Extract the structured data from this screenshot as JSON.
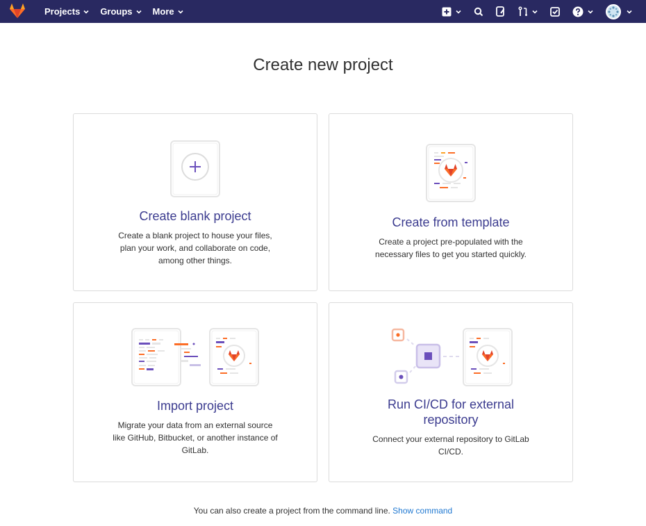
{
  "navbar": {
    "items": [
      {
        "label": "Projects"
      },
      {
        "label": "Groups"
      },
      {
        "label": "More"
      }
    ]
  },
  "page": {
    "title": "Create new project"
  },
  "cards": [
    {
      "title": "Create blank project",
      "description": "Create a blank project to house your files, plan your work, and collaborate on code, among other things."
    },
    {
      "title": "Create from template",
      "description": "Create a project pre-populated with the necessary files to get you started quickly."
    },
    {
      "title": "Import project",
      "description": "Migrate your data from an external source like GitHub, Bitbucket, or another instance of GitLab."
    },
    {
      "title": "Run CI/CD for external repository",
      "description": "Connect your external repository to GitLab CI/CD."
    }
  ],
  "footer": {
    "text": "You can also create a project from the command line.",
    "link": "Show command"
  },
  "colors": {
    "navbar": "#292961",
    "title_accent": "#3b3b8f",
    "link": "#1f78d1",
    "orange": "#fc6d26",
    "purple": "#6b4fbb"
  }
}
